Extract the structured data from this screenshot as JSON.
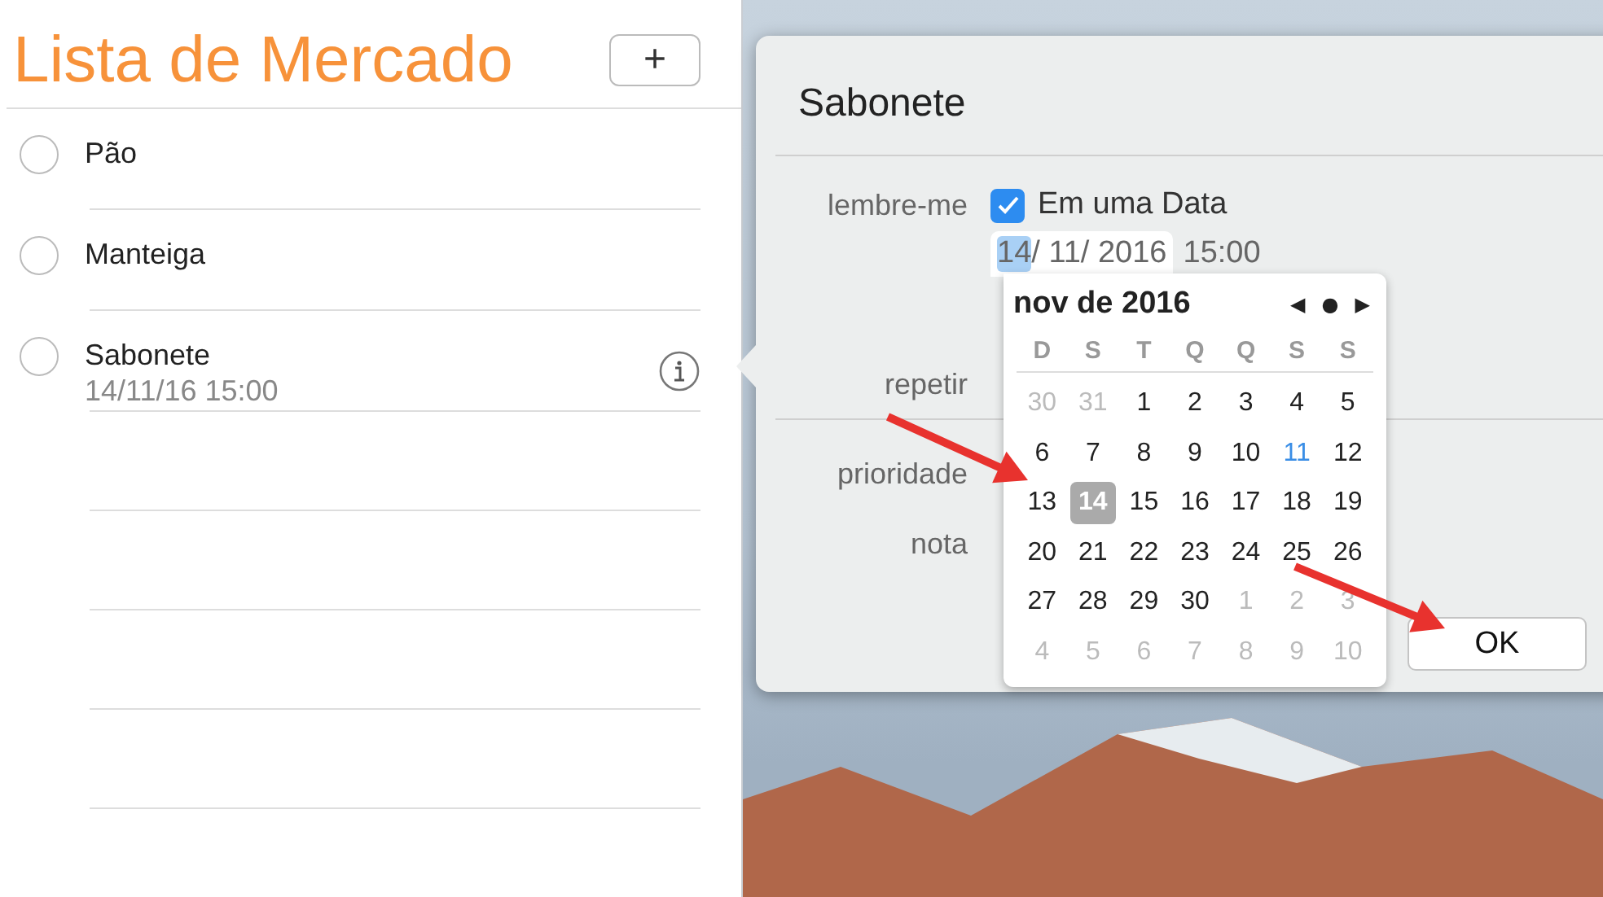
{
  "list": {
    "title": "Lista de Mercado",
    "add_button": "+",
    "items": [
      {
        "title": "Pão",
        "checked": false,
        "selected": false
      },
      {
        "title": "Manteiga",
        "checked": false,
        "selected": false
      },
      {
        "title": "Sabonete",
        "subtitle": "14/11/16 15:00",
        "checked": false,
        "selected": true
      }
    ]
  },
  "popover": {
    "title": "Sabonete",
    "remind_label": "lembre-me",
    "remind_checkbox": {
      "label": "Em uma Data",
      "checked": true
    },
    "date_field": {
      "day": "14",
      "rest": "/ 11/ 2016",
      "day_selected": true
    },
    "time_field": "15:00",
    "repeat_label": "repetir",
    "priority_label": "prioridade",
    "note_label": "nota",
    "ok_button": "OK"
  },
  "calendar": {
    "month": "nov de 2016",
    "nav": [
      "◀",
      "●",
      "▶"
    ],
    "weekdays": [
      "D",
      "S",
      "T",
      "Q",
      "Q",
      "S",
      "S"
    ],
    "weeks": [
      [
        {
          "label": "30",
          "muted": true
        },
        {
          "label": "31",
          "muted": true
        },
        {
          "label": "1",
          "muted": false
        },
        {
          "label": "2",
          "muted": false
        },
        {
          "label": "3",
          "muted": false
        },
        {
          "label": "4",
          "muted": false
        },
        {
          "label": "5",
          "muted": false
        }
      ],
      [
        {
          "label": "6",
          "muted": false
        },
        {
          "label": "7",
          "muted": false
        },
        {
          "label": "8",
          "muted": false
        },
        {
          "label": "9",
          "muted": false
        },
        {
          "label": "10",
          "muted": false
        },
        {
          "label": "11",
          "muted": false,
          "today": true
        },
        {
          "label": "12",
          "muted": false
        }
      ],
      [
        {
          "label": "13",
          "muted": false
        },
        {
          "label": "14",
          "muted": false,
          "selected": true
        },
        {
          "label": "15",
          "muted": false
        },
        {
          "label": "16",
          "muted": false
        },
        {
          "label": "17",
          "muted": false
        },
        {
          "label": "18",
          "muted": false
        },
        {
          "label": "19",
          "muted": false
        }
      ],
      [
        {
          "label": "20",
          "muted": false
        },
        {
          "label": "21",
          "muted": false
        },
        {
          "label": "22",
          "muted": false
        },
        {
          "label": "23",
          "muted": false
        },
        {
          "label": "24",
          "muted": false
        },
        {
          "label": "25",
          "muted": false
        },
        {
          "label": "26",
          "muted": false
        }
      ],
      [
        {
          "label": "27",
          "muted": false
        },
        {
          "label": "28",
          "muted": false
        },
        {
          "label": "29",
          "muted": false
        },
        {
          "label": "30",
          "muted": false
        },
        {
          "label": "1",
          "muted": true
        },
        {
          "label": "2",
          "muted": true
        },
        {
          "label": "3",
          "muted": true
        }
      ],
      [
        {
          "label": "4",
          "muted": true
        },
        {
          "label": "5",
          "muted": true
        },
        {
          "label": "6",
          "muted": true
        },
        {
          "label": "7",
          "muted": true
        },
        {
          "label": "8",
          "muted": true
        },
        {
          "label": "9",
          "muted": true
        },
        {
          "label": "10",
          "muted": true
        }
      ]
    ]
  }
}
